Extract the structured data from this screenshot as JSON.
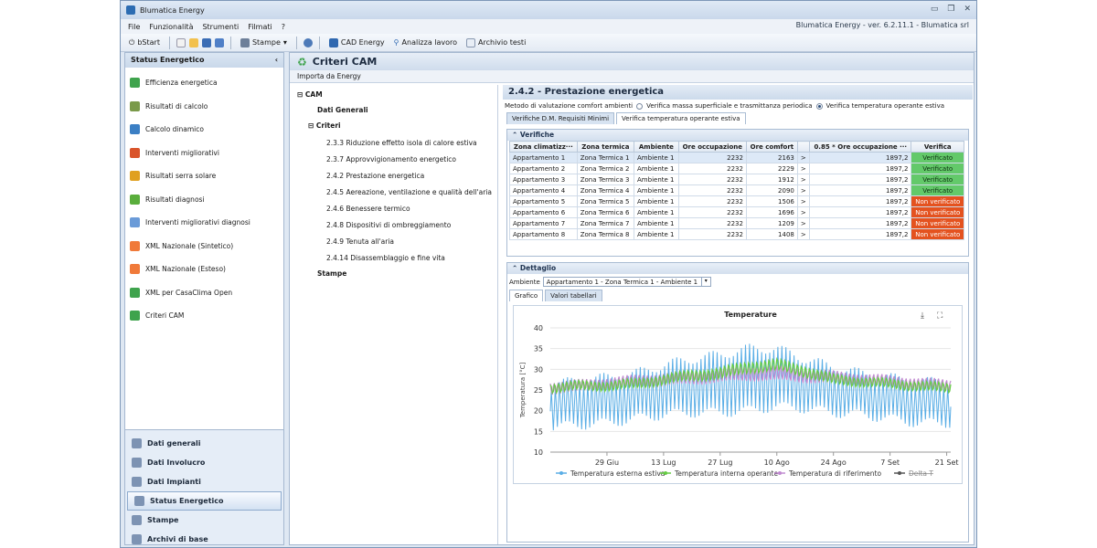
{
  "app": {
    "title": "Blumatica Energy",
    "version_text": "Blumatica Energy - ver. 6.2.11.1 - Blumatica srl",
    "menu": [
      "File",
      "Funzionalità",
      "Strumenti",
      "Filmati",
      "?"
    ],
    "toolbar": {
      "bstart": "bStart",
      "stampe": "Stampe",
      "cad": "CAD Energy",
      "analizza": "Analizza lavoro",
      "archivio": "Archivio testi"
    }
  },
  "sidebar": {
    "title": "Status Energetico",
    "collapse": "‹",
    "items": [
      {
        "label": "Efficienza energetica",
        "icon": "energy-class-icon",
        "color": "#3fa34d"
      },
      {
        "label": "Risultati di calcolo",
        "icon": "calculator-icon",
        "color": "#7a9a4a"
      },
      {
        "label": "Calcolo dinamico",
        "icon": "wave-icon",
        "color": "#3b7fc4"
      },
      {
        "label": "Interventi migliorativi",
        "icon": "improvement-icon",
        "color": "#d9542b"
      },
      {
        "label": "Risultati serra solare",
        "icon": "greenhouse-icon",
        "color": "#e0a020"
      },
      {
        "label": "Risultati diagnosi",
        "icon": "leaf-icon",
        "color": "#5aae3c"
      },
      {
        "label": "Interventi migliorativi diagnosi",
        "icon": "wrench-icon",
        "color": "#6a9bd8"
      },
      {
        "label": "XML Nazionale (Sintetico)",
        "icon": "xml-icon",
        "color": "#f07a3a"
      },
      {
        "label": "XML Nazionale (Esteso)",
        "icon": "xml-icon",
        "color": "#f07a3a"
      },
      {
        "label": "XML per CasaClima Open",
        "icon": "casaclima-icon",
        "color": "#3fa34d"
      },
      {
        "label": "Criteri CAM",
        "icon": "recycle-icon",
        "color": "#3fa34d"
      }
    ],
    "bottom": [
      {
        "label": "Dati generali",
        "icon": "building-icon"
      },
      {
        "label": "Dati Involucro",
        "icon": "wall-icon"
      },
      {
        "label": "Dati Impianti",
        "icon": "plant-icon"
      },
      {
        "label": "Status Energetico",
        "icon": "energy-class-icon",
        "active": true
      },
      {
        "label": "Stampe",
        "icon": "printer-icon"
      },
      {
        "label": "Archivi di base",
        "icon": "folder-icon"
      }
    ]
  },
  "main": {
    "title": "Criteri CAM",
    "import_label": "Importa da Energy",
    "tree": {
      "root": "CAM",
      "dati_generali": "Dati Generali",
      "criteri": "Criteri",
      "items": [
        "2.3.3 Riduzione effetto isola di calore estiva",
        "2.3.7 Approvvigionamento energetico",
        "2.4.2 Prestazione energetica",
        "2.4.5 Aereazione, ventilazione e qualità dell'aria",
        "2.4.6 Benessere termico",
        "2.4.8 Dispositivi di ombreggiamento",
        "2.4.9 Tenuta all'aria",
        "2.4.14 Disassemblaggio e fine vita"
      ],
      "stampe": "Stampe"
    },
    "panel": {
      "title": "2.4.2 - Prestazione energetica",
      "method_label": "Metodo di valutazione comfort ambienti",
      "method_opt1": "Verifica massa superficiale e trasmittanza periodica",
      "method_opt2": "Verifica temperatura operante estiva",
      "tab1": "Verifiche D.M. Requisiti Minimi",
      "tab2": "Verifica temperatura operante estiva",
      "verifiche_title": "Verifiche",
      "columns": [
        "Zona climatizz···",
        "Zona termica",
        "Ambiente",
        "Ore occupazione",
        "Ore comfort",
        "",
        "0.85 * Ore occupazione ···",
        "Verifica"
      ],
      "rows": [
        [
          "Appartamento 1",
          "Zona Termica 1",
          "Ambiente 1",
          "2232",
          "2163",
          ">",
          "1897,2",
          "Verificato"
        ],
        [
          "Appartamento 2",
          "Zona Termica 2",
          "Ambiente 1",
          "2232",
          "2229",
          ">",
          "1897,2",
          "Verificato"
        ],
        [
          "Appartamento 3",
          "Zona Termica 3",
          "Ambiente 1",
          "2232",
          "1912",
          ">",
          "1897,2",
          "Verificato"
        ],
        [
          "Appartamento 4",
          "Zona Termica 4",
          "Ambiente 1",
          "2232",
          "2090",
          ">",
          "1897,2",
          "Verificato"
        ],
        [
          "Appartamento 5",
          "Zona Termica 5",
          "Ambiente 1",
          "2232",
          "1506",
          ">",
          "1897,2",
          "Non verificato"
        ],
        [
          "Appartamento 6",
          "Zona Termica 6",
          "Ambiente 1",
          "2232",
          "1696",
          ">",
          "1897,2",
          "Non verificato"
        ],
        [
          "Appartamento 7",
          "Zona Termica 7",
          "Ambiente 1",
          "2232",
          "1209",
          ">",
          "1897,2",
          "Non verificato"
        ],
        [
          "Appartamento 8",
          "Zona Termica 8",
          "Ambiente 1",
          "2232",
          "1408",
          ">",
          "1897,2",
          "Non verificato"
        ]
      ],
      "dettaglio_title": "Dettaglio",
      "ambiente_label": "Ambiente",
      "ambiente_value": "Appartamento 1 - Zona Termica 1 - Ambiente 1",
      "tab_grafico": "Grafico",
      "tab_valori": "Valori tabellari"
    }
  },
  "chart_data": {
    "type": "line",
    "title": "Temperature",
    "ylabel": "Temperatura [°C]",
    "ylim": [
      10,
      40
    ],
    "yticks": [
      10,
      15,
      20,
      25,
      30,
      35,
      40
    ],
    "xlim": [
      "2024-06-15",
      "2024-09-22"
    ],
    "xticks": [
      {
        "date": "2024-06-29",
        "label": "29 Giu"
      },
      {
        "date": "2024-07-13",
        "label": "13 Lug"
      },
      {
        "date": "2024-07-27",
        "label": "27 Lug"
      },
      {
        "date": "2024-08-10",
        "label": "10 Ago"
      },
      {
        "date": "2024-08-24",
        "label": "24 Ago"
      },
      {
        "date": "2024-09-07",
        "label": "7 Set"
      },
      {
        "date": "2024-09-21",
        "label": "21 Set"
      }
    ],
    "series": [
      {
        "name": "Temperatura esterna estiva",
        "color": "#5aaee6",
        "x": [
          "2024-06-15",
          "2024-06-22",
          "2024-06-29",
          "2024-07-06",
          "2024-07-13",
          "2024-07-20",
          "2024-07-27",
          "2024-08-03",
          "2024-08-10",
          "2024-08-17",
          "2024-08-24",
          "2024-08-31",
          "2024-09-07",
          "2024-09-14",
          "2024-09-21"
        ],
        "mean": [
          21,
          22,
          22.5,
          23.5,
          25,
          26,
          26.5,
          27.5,
          28,
          26.5,
          25,
          24,
          23,
          22,
          22
        ],
        "amp": [
          5,
          5.5,
          5.5,
          5.5,
          6,
          6.5,
          7,
          7.5,
          7,
          6,
          5.5,
          5,
          5,
          5,
          5
        ]
      },
      {
        "name": "Temperatura interna operante",
        "color": "#66cc44",
        "x": [
          "2024-06-15",
          "2024-06-22",
          "2024-06-29",
          "2024-07-06",
          "2024-07-13",
          "2024-07-20",
          "2024-07-27",
          "2024-08-03",
          "2024-08-10",
          "2024-08-17",
          "2024-08-24",
          "2024-08-31",
          "2024-09-07",
          "2024-09-14",
          "2024-09-21"
        ],
        "mean": [
          25.5,
          26,
          26,
          26.5,
          27.5,
          28.5,
          29,
          30.5,
          31,
          29.5,
          27.5,
          27,
          26.5,
          26,
          25.5
        ],
        "amp": [
          1.2,
          1.2,
          1.2,
          1.3,
          1.3,
          1.4,
          1.5,
          1.5,
          1.5,
          1.4,
          1.3,
          1.2,
          1.2,
          1.2,
          1.2
        ]
      },
      {
        "name": "Temperatura di riferimento",
        "color": "#c08ad0",
        "x": [
          "2024-06-15",
          "2024-06-22",
          "2024-06-29",
          "2024-07-06",
          "2024-07-13",
          "2024-07-20",
          "2024-07-27",
          "2024-08-03",
          "2024-08-10",
          "2024-08-17",
          "2024-08-24",
          "2024-08-31",
          "2024-09-07",
          "2024-09-14",
          "2024-09-21"
        ],
        "mean": [
          25.5,
          26,
          26.5,
          27,
          27.5,
          28,
          28.5,
          29,
          29,
          28.5,
          28,
          27.5,
          27,
          26.5,
          26
        ],
        "amp": [
          1.5,
          1.5,
          1.5,
          1.6,
          1.6,
          1.7,
          1.7,
          1.8,
          1.8,
          1.7,
          1.6,
          1.5,
          1.5,
          1.5,
          1.5
        ]
      },
      {
        "name": "Delta T",
        "color": "#555555",
        "hidden": true
      }
    ],
    "legend_position": "bottom"
  }
}
